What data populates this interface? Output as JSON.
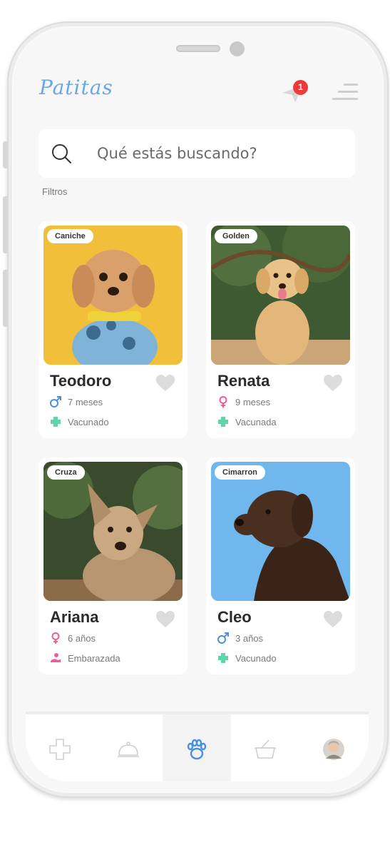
{
  "app": {
    "brand": "Patitas",
    "notification_count": "1"
  },
  "search": {
    "placeholder": "Qué estás buscando?"
  },
  "filters_label": "Filtros",
  "pets": [
    {
      "breed": "Caniche",
      "name": "Teodoro",
      "sex": "male",
      "age": "7 meses",
      "status": "Vacunado",
      "status_icon": "cross-icon"
    },
    {
      "breed": "Golden",
      "name": "Renata",
      "sex": "female",
      "age": "9 meses",
      "status": "Vacunada",
      "status_icon": "cross-icon"
    },
    {
      "breed": "Cruza",
      "name": "Ariana",
      "sex": "female",
      "age": "6 años",
      "status": "Embarazada",
      "status_icon": "pregnant-icon"
    },
    {
      "breed": "Cimarron",
      "name": "Cleo",
      "sex": "male",
      "age": "3 años",
      "status": "Vacunado",
      "status_icon": "cross-icon"
    }
  ],
  "tabs": [
    {
      "icon": "health-cross-icon",
      "active": false
    },
    {
      "icon": "food-bell-icon",
      "active": false
    },
    {
      "icon": "paw-icon",
      "active": true
    },
    {
      "icon": "basket-icon",
      "active": false
    },
    {
      "icon": "profile-avatar",
      "active": false
    }
  ],
  "colors": {
    "brand": "#6aa6e8",
    "badge": "#f03a3a",
    "male": "#4a8fe0",
    "female": "#ec5d9a",
    "vaccine": "#5fd6a8",
    "heart": "#dcdcdc"
  }
}
